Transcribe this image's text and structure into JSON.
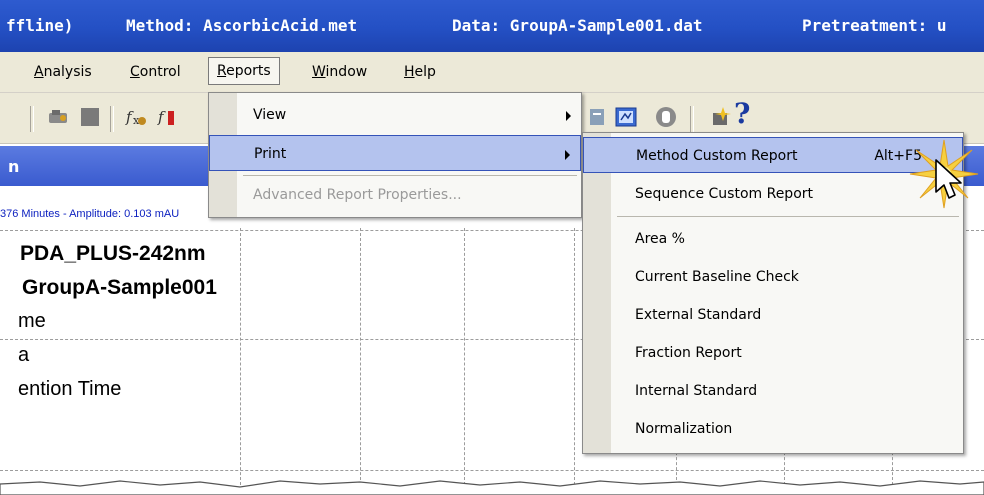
{
  "titlebar": {
    "app_fragment": "ffline)",
    "method": "Method: AscorbicAcid.met",
    "data": "Data: GroupA-Sample001.dat",
    "pretreatment": "Pretreatment: u"
  },
  "menubar": {
    "items": [
      {
        "label": "Analysis",
        "accel": "A",
        "rest": "nalysis"
      },
      {
        "label": "Control",
        "accel": "C",
        "rest": "ontrol"
      },
      {
        "label": "Reports",
        "accel": "R",
        "rest": "eports"
      },
      {
        "label": "Window",
        "accel": "W",
        "rest": "indow"
      },
      {
        "label": "Help",
        "accel": "H",
        "rest": "elp"
      }
    ]
  },
  "toolbar": {
    "icons": [
      "wrench-icon",
      "stop-icon",
      "fx-icon",
      "fx-red-icon",
      "report-icon",
      "zoom-icon",
      "hand-icon",
      "sparkle-icon",
      "help-icon"
    ],
    "help_glyph": "?"
  },
  "panel": {
    "header_fragment": "n"
  },
  "status": {
    "text": "376 Minutes - Amplitude: 0.103 mAU"
  },
  "chart": {
    "lines": [
      "PDA_PLUS-242nm",
      "GroupA-Sample001",
      "me",
      "a",
      "ention Time"
    ]
  },
  "reports_menu": {
    "items": [
      {
        "label": "View",
        "submenu": true,
        "disabled": false
      },
      {
        "label": "Print",
        "submenu": true,
        "disabled": false,
        "highlighted": true
      },
      {
        "label": "Advanced Report Properties...",
        "submenu": false,
        "disabled": true
      }
    ]
  },
  "print_submenu": {
    "items": [
      {
        "label": "Method Custom Report",
        "shortcut": "Alt+F5",
        "highlighted": true
      },
      {
        "label": "Sequence Custom Report",
        "shortcut": ""
      },
      {
        "label": "Area %",
        "shortcut": ""
      },
      {
        "label": "Current Baseline Check",
        "shortcut": ""
      },
      {
        "label": "External Standard",
        "shortcut": ""
      },
      {
        "label": "Fraction Report",
        "shortcut": ""
      },
      {
        "label": "Internal Standard",
        "shortcut": ""
      },
      {
        "label": "Normalization",
        "shortcut": ""
      }
    ]
  },
  "colors": {
    "title_bg": "#2450c4",
    "menu_bg": "#ece9d8",
    "highlight": "#b4c3ee",
    "highlight_border": "#3553b8",
    "status_text": "#0b1fbf"
  }
}
